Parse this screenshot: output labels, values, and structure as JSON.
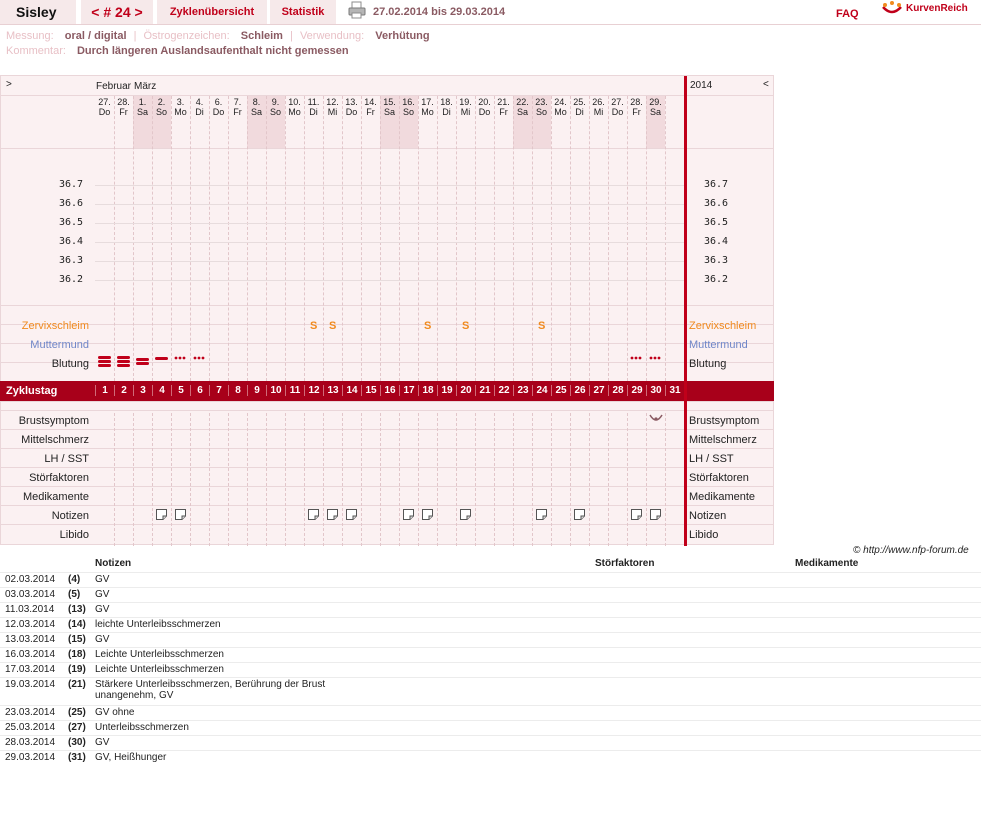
{
  "header": {
    "name": "Sisley",
    "cycle_label": "< # 24 >",
    "overview_tab": "Zyklenübersicht",
    "stats_tab": "Statistik",
    "date_range": "27.02.2014 bis 29.03.2014",
    "faq": "FAQ",
    "logo": "KurvenReich",
    "icons": {
      "print": "printer-icon",
      "logo": "kurvenreich-logo"
    }
  },
  "info": {
    "measurement_label": "Messung:",
    "measurement_value": "oral / digital",
    "estrogen_label": "Östrogenzeichen:",
    "estrogen_value": "Schleim",
    "usage_label": "Verwendung:",
    "usage_value": "Verhütung",
    "comment_label": "Kommentar:",
    "comment_value": "Durch längeren Auslandsaufenthalt nicht gemessen"
  },
  "chart": {
    "nav_left": ">",
    "nav_right": "<",
    "month_feb": "Februar",
    "month_mar": "März",
    "year": "2014",
    "days": [
      {
        "date": "27.",
        "wd": "Do"
      },
      {
        "date": "28.",
        "wd": "Fr"
      },
      {
        "date": "1.",
        "wd": "Sa"
      },
      {
        "date": "2.",
        "wd": "So"
      },
      {
        "date": "3.",
        "wd": "Mo"
      },
      {
        "date": "4.",
        "wd": "Di"
      },
      {
        "date": "6.",
        "wd": "Do"
      },
      {
        "date": "7.",
        "wd": "Fr"
      },
      {
        "date": "8.",
        "wd": "Sa"
      },
      {
        "date": "9.",
        "wd": "So"
      },
      {
        "date": "10.",
        "wd": "Mo"
      },
      {
        "date": "11.",
        "wd": "Di"
      },
      {
        "date": "12.",
        "wd": "Mi"
      },
      {
        "date": "13.",
        "wd": "Do"
      },
      {
        "date": "14.",
        "wd": "Fr"
      },
      {
        "date": "15.",
        "wd": "Sa"
      },
      {
        "date": "16.",
        "wd": "So"
      },
      {
        "date": "17.",
        "wd": "Mo"
      },
      {
        "date": "18.",
        "wd": "Di"
      },
      {
        "date": "19.",
        "wd": "Mi"
      },
      {
        "date": "20.",
        "wd": "Do"
      },
      {
        "date": "21.",
        "wd": "Fr"
      },
      {
        "date": "22.",
        "wd": "Sa"
      },
      {
        "date": "23.",
        "wd": "So"
      },
      {
        "date": "24.",
        "wd": "Mo"
      },
      {
        "date": "25.",
        "wd": "Di"
      },
      {
        "date": "26.",
        "wd": "Mi"
      },
      {
        "date": "27.",
        "wd": "Do"
      },
      {
        "date": "28.",
        "wd": "Fr"
      },
      {
        "date": "29.",
        "wd": "Sa"
      }
    ],
    "temperatures": [
      "36.7",
      "36.6",
      "36.5",
      "36.4",
      "36.3",
      "36.2"
    ],
    "rows": {
      "cervical_mucus": "Zervixschleim",
      "cervix": "Muttermund",
      "bleeding": "Blutung",
      "cycle_day": "Zyklustag",
      "breast": "Brustsymptom",
      "midpain": "Mittelschmerz",
      "lh": "LH / SST",
      "disturb": "Störfaktoren",
      "meds": "Medikamente",
      "notes": "Notizen",
      "libido": "Libido"
    },
    "mucus_marks": [
      12,
      13,
      18,
      20,
      24
    ],
    "mucus_symbol": "S",
    "bleeding": [
      {
        "col": 1,
        "type": "heavy"
      },
      {
        "col": 2,
        "type": "heavy"
      },
      {
        "col": 3,
        "type": "medium"
      },
      {
        "col": 4,
        "type": "light"
      },
      {
        "col": 5,
        "type": "spotting"
      },
      {
        "col": 6,
        "type": "spotting"
      },
      {
        "col": 29,
        "type": "spotting"
      },
      {
        "col": 30,
        "type": "spotting"
      }
    ],
    "breast_marks": [
      30
    ],
    "note_marks": [
      4,
      5,
      12,
      13,
      14,
      17,
      18,
      20,
      24,
      26,
      29,
      30
    ],
    "cycle_days": [
      "1",
      "2",
      "3",
      "4",
      "5",
      "6",
      "7",
      "8",
      "9",
      "10",
      "11",
      "12",
      "13",
      "14",
      "15",
      "16",
      "17",
      "18",
      "19",
      "20",
      "21",
      "22",
      "23",
      "24",
      "25",
      "26",
      "27",
      "28",
      "29",
      "30",
      "31"
    ]
  },
  "footer": {
    "copyright": "© http://www.nfp-forum.de"
  },
  "notes_table": {
    "headers": {
      "notes": "Notizen",
      "disturb": "Störfaktoren",
      "meds": "Medikamente"
    },
    "rows": [
      {
        "date": "02.03.2014",
        "day": "(4)",
        "text": "GV"
      },
      {
        "date": "03.03.2014",
        "day": "(5)",
        "text": "GV"
      },
      {
        "date": "11.03.2014",
        "day": "(13)",
        "text": "GV"
      },
      {
        "date": "12.03.2014",
        "day": "(14)",
        "text": "leichte Unterleibsschmerzen"
      },
      {
        "date": "13.03.2014",
        "day": "(15)",
        "text": "GV"
      },
      {
        "date": "16.03.2014",
        "day": "(18)",
        "text": "Leichte Unterleibsschmerzen"
      },
      {
        "date": "17.03.2014",
        "day": "(19)",
        "text": "Leichte Unterleibsschmerzen"
      },
      {
        "date": "19.03.2014",
        "day": "(21)",
        "text": "Stärkere Unterleibsschmerzen, Berührung der Brust unangenehm, GV"
      },
      {
        "date": "23.03.2014",
        "day": "(25)",
        "text": "GV ohne"
      },
      {
        "date": "25.03.2014",
        "day": "(27)",
        "text": "Unterleibsschmerzen"
      },
      {
        "date": "28.03.2014",
        "day": "(30)",
        "text": "GV"
      },
      {
        "date": "29.03.2014",
        "day": "(31)",
        "text": "GV, Heißhunger"
      }
    ]
  }
}
